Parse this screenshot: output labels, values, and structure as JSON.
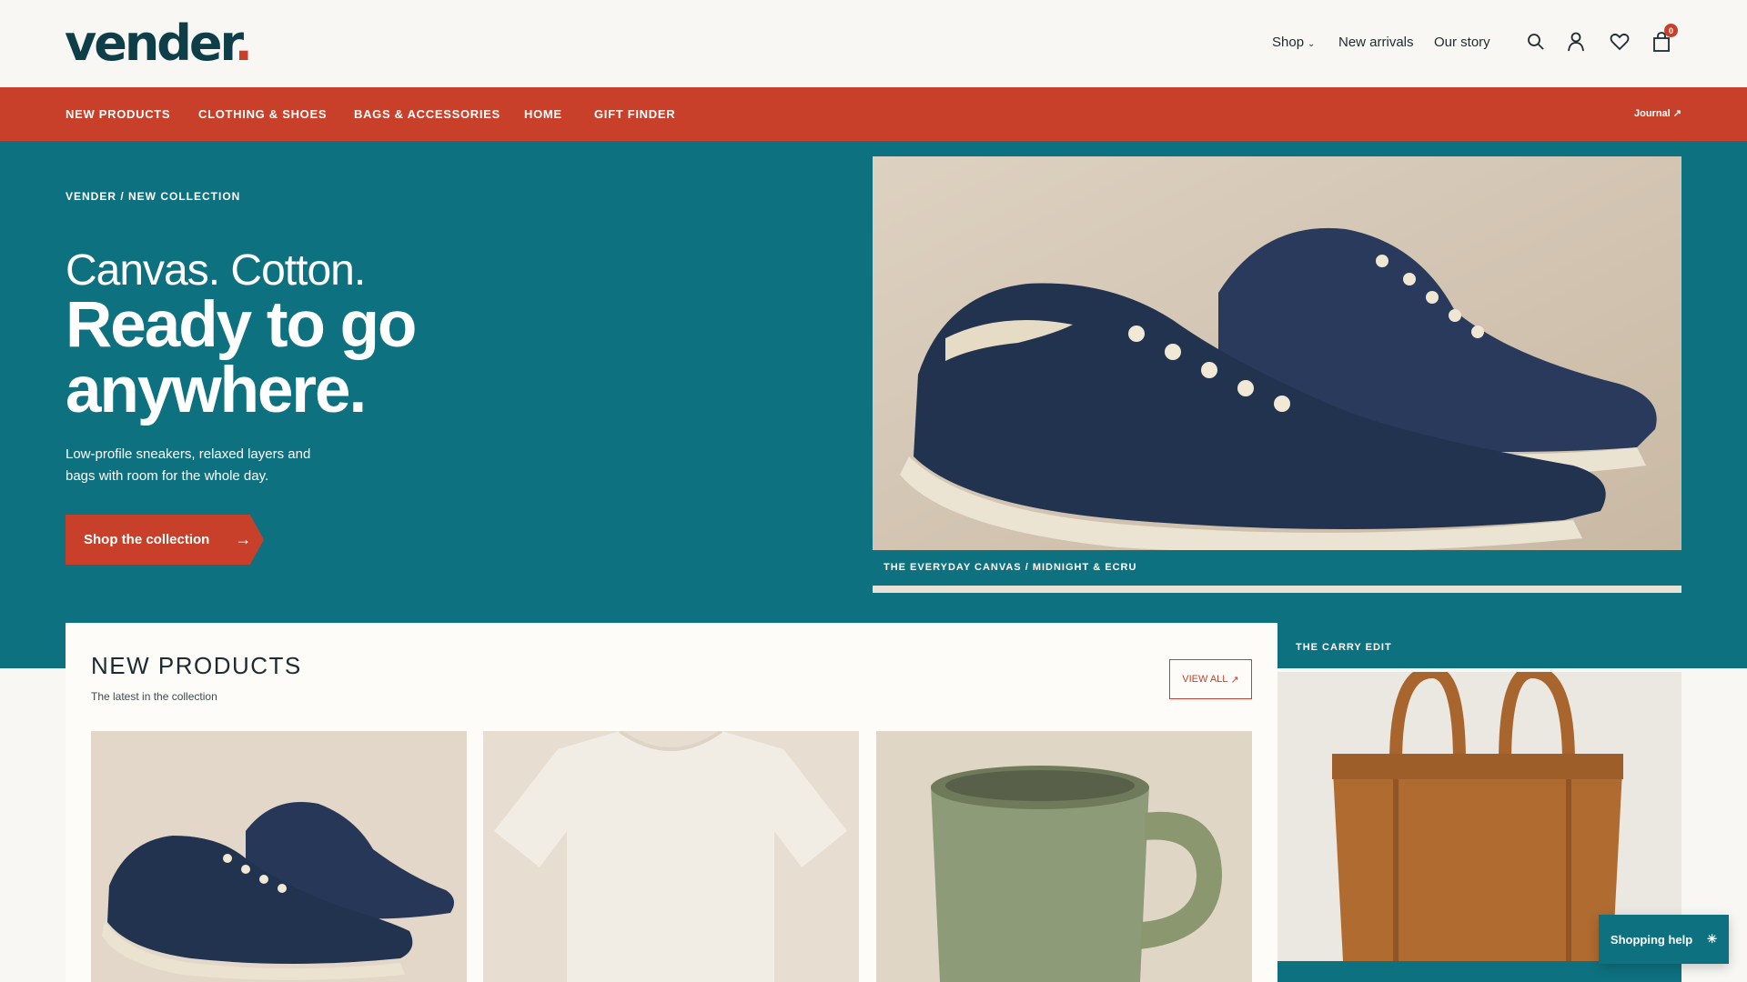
{
  "brand": {
    "name": "vender",
    "dot": ".",
    "color": "#0e3f49",
    "accent": "#c8402a",
    "teal": "#0e7180"
  },
  "topnav": {
    "shop": "Shop",
    "new_arrivals": "New arrivals",
    "our_story": "Our story"
  },
  "header_icons": {
    "search": "search-icon",
    "account": "user-icon",
    "wishlist": "heart-icon",
    "cart": "bag-icon",
    "cart_count": "0"
  },
  "categories": [
    "NEW PRODUCTS",
    "CLOTHING & SHOES",
    "BAGS & ACCESSORIES",
    "HOME",
    "GIFT FINDER"
  ],
  "journal": "Journal",
  "hero": {
    "breadcrumb": "VENDER / NEW COLLECTION",
    "headline_1": "Canvas. Cotton.",
    "headline_2": "Ready to go anywhere.",
    "subtitle": "Low-profile sneakers, relaxed layers and bags with room for the whole day.",
    "cta": "Shop the collection",
    "image_caption": "THE EVERYDAY CANVAS / MIDNIGHT & ECRU"
  },
  "new_products": {
    "title": "NEW PRODUCTS",
    "subtitle": "The latest in the collection",
    "view_all": "VIEW ALL",
    "items": [
      "sneakers",
      "t-shirt",
      "mug"
    ]
  },
  "carry_edit": {
    "label": "THE CARRY EDIT"
  },
  "help": {
    "label": "Shopping help"
  }
}
